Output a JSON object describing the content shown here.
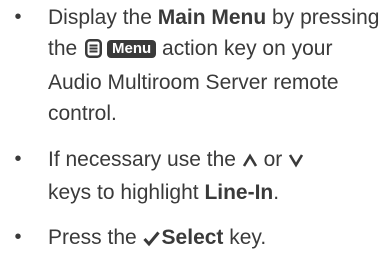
{
  "instructions": {
    "bullet": "•",
    "step1": {
      "text_a": "Display the ",
      "main_menu": "Main Menu",
      "text_b": " by pressing the ",
      "menu_key_label": "Menu",
      "text_c": " action key on your Audio Multiroom Server remote control.",
      "icon": "menu-list-icon"
    },
    "step2": {
      "text_a": "If necessary use the ",
      "text_b": " or ",
      "text_c": " keys to highlight ",
      "line_in": "Line-In",
      "text_d": ".",
      "icons": [
        "up-arrow-icon",
        "down-arrow-icon"
      ]
    },
    "step3": {
      "text_a": "Press the ",
      "select": "Select",
      "text_b": " key.",
      "icon": "checkmark-icon"
    }
  },
  "colors": {
    "text": "#3a3a3a",
    "key_background": "#3a3a3a",
    "key_text": "#ffffff"
  }
}
